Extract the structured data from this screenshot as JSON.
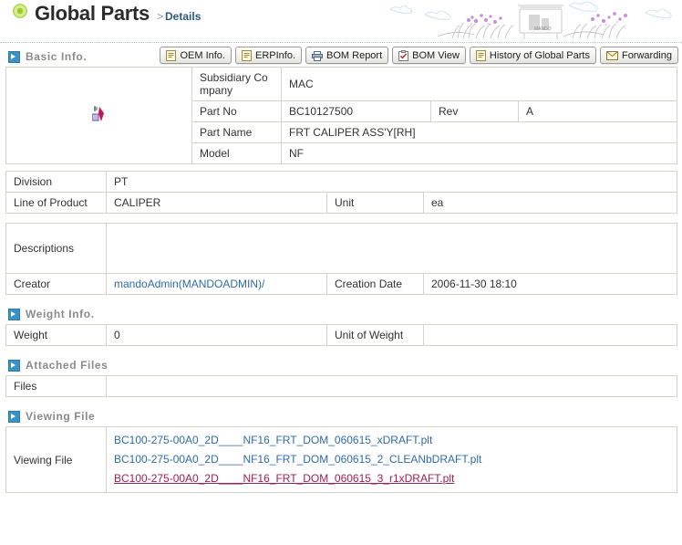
{
  "header": {
    "title": "Global Parts",
    "breadcrumb_chevron": ">",
    "breadcrumb": "Details",
    "bullet_icon": "green-circle-icon",
    "art_label": "MANDO"
  },
  "sections": {
    "basic": {
      "label": "Basic Info.",
      "icon": "arrow-square-icon"
    },
    "weight": {
      "label": "Weight Info.",
      "icon": "arrow-square-icon"
    },
    "attached": {
      "label": "Attached Files",
      "icon": "arrow-square-icon"
    },
    "viewing": {
      "label": "Viewing File",
      "icon": "arrow-square-icon"
    }
  },
  "toolbar": {
    "buttons": [
      {
        "label": "OEM Info.",
        "icon": "document-icon"
      },
      {
        "label": "ERPInfo.",
        "icon": "document-icon"
      },
      {
        "label": "BOM Report",
        "icon": "printer-icon"
      },
      {
        "label": "BOM View",
        "icon": "clipboard-check-icon"
      },
      {
        "label": "History of Global Parts",
        "icon": "document-icon"
      },
      {
        "label": "Forwarding",
        "icon": "envelope-icon"
      }
    ]
  },
  "basic_info": {
    "image_placeholder": "broken-image-icon",
    "subsidiary_company_label": "Subsidiary Company",
    "subsidiary_company_value": "MAC",
    "part_no_label": "Part No",
    "part_no_value": "BC10127500",
    "rev_label": "Rev",
    "rev_value": "A",
    "part_name_label": "Part Name",
    "part_name_value": "FRT CALIPER ASS'Y[RH]",
    "model_label": "Model",
    "model_value": "NF",
    "division_label": "Division",
    "division_value": "PT",
    "line_of_product_label": "Line of Product",
    "line_of_product_value": "CALIPER",
    "unit_label": "Unit",
    "unit_value": "ea",
    "descriptions_label": "Descriptions",
    "descriptions_value": "",
    "creator_label": "Creator",
    "creator_value": "mandoAdmin(MANDOADMIN)/",
    "creation_date_label": "Creation Date",
    "creation_date_value": "2006-11-30 18:10"
  },
  "weight_info": {
    "weight_label": "Weight",
    "weight_value": "0",
    "unit_of_weight_label": "Unit of Weight",
    "unit_of_weight_value": ""
  },
  "attached_files": {
    "files_label": "Files",
    "files_value": ""
  },
  "viewing_file": {
    "label": "Viewing File",
    "files": [
      "BC100-275-00A0_2D____NF16_FRT_DOM_060615_xDRAFT.plt",
      "BC100-275-00A0_2D____NF16_FRT_DOM_060615_2_CLEANbDRAFT.plt",
      "BC100-275-00A0_2D____NF16_FRT_DOM_060615_3_r1xDRAFT.plt"
    ]
  },
  "colors": {
    "label_bg": "#eeeecd",
    "image_cell_bg": "#e4f6f1",
    "link": "#2f6ca8",
    "visited_link": "#a02050",
    "section_icon": "#3b92c4",
    "title_bullet": "#9ecb28"
  }
}
